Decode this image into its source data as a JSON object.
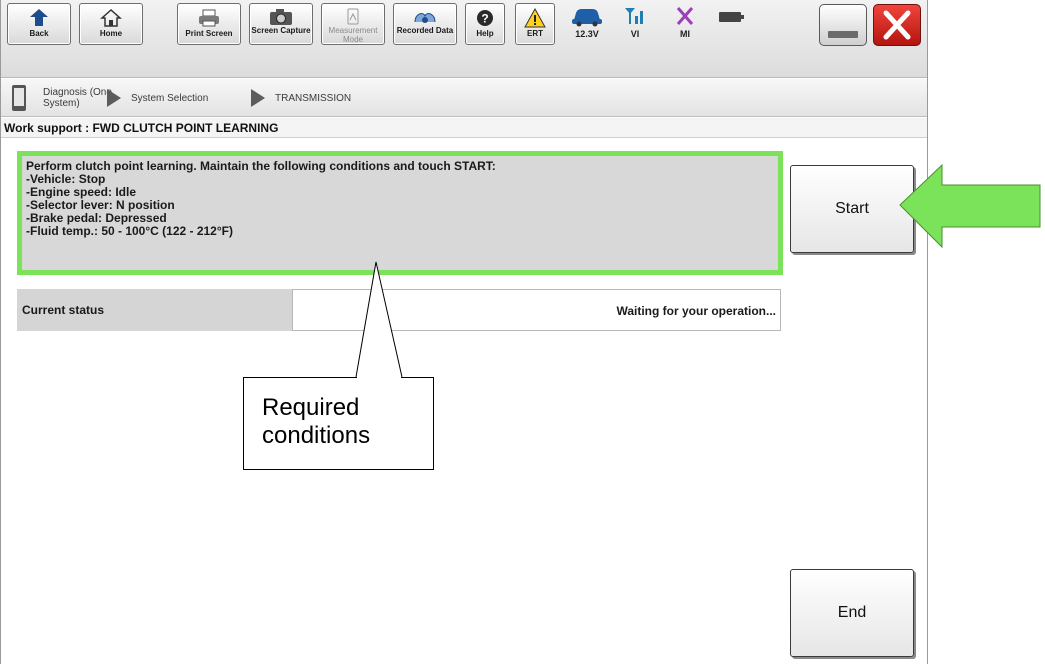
{
  "toolbar": {
    "buttons": [
      {
        "label": "Back",
        "icon": "back-arrow-icon"
      },
      {
        "label": "Home",
        "icon": "home-icon"
      },
      {
        "label": "Print Screen",
        "icon": "printer-icon"
      },
      {
        "label": "Screen Capture",
        "icon": "camera-icon"
      },
      {
        "label": "Measurement Mode",
        "icon": "measurement-icon",
        "disabled": true
      },
      {
        "label": "Recorded Data",
        "icon": "recorded-data-icon"
      },
      {
        "label": "Help",
        "icon": "help-icon"
      },
      {
        "label": "ERT",
        "icon": "warning-icon"
      }
    ],
    "status": [
      {
        "label": "12.3V",
        "icon": "car-battery-icon"
      },
      {
        "label": "VI",
        "icon": "signal-icon"
      },
      {
        "label": "MI",
        "icon": "mi-x-icon"
      },
      {
        "label": "",
        "icon": "battery-bar-icon"
      }
    ]
  },
  "breadcrumb": {
    "items": [
      "Diagnosis (One System)",
      "System Selection",
      "TRANSMISSION"
    ]
  },
  "work_support": {
    "title": "Work support : FWD CLUTCH POINT LEARNING"
  },
  "conditions": {
    "lines": [
      "Perform clutch point learning. Maintain the following conditions and touch START:",
      "-Vehicle: Stop",
      "-Engine speed: Idle",
      "-Selector lever: N position",
      "-Brake pedal: Depressed",
      "-Fluid temp.: 50 - 100°C (122 - 212°F)"
    ]
  },
  "status": {
    "label": "Current status",
    "value": "Waiting for your operation..."
  },
  "buttons": {
    "start": "Start",
    "end": "End"
  },
  "callout": {
    "line1": "Required",
    "line2": "conditions"
  },
  "colors": {
    "highlight_green": "#7be35a",
    "close_red": "#d42a22"
  }
}
